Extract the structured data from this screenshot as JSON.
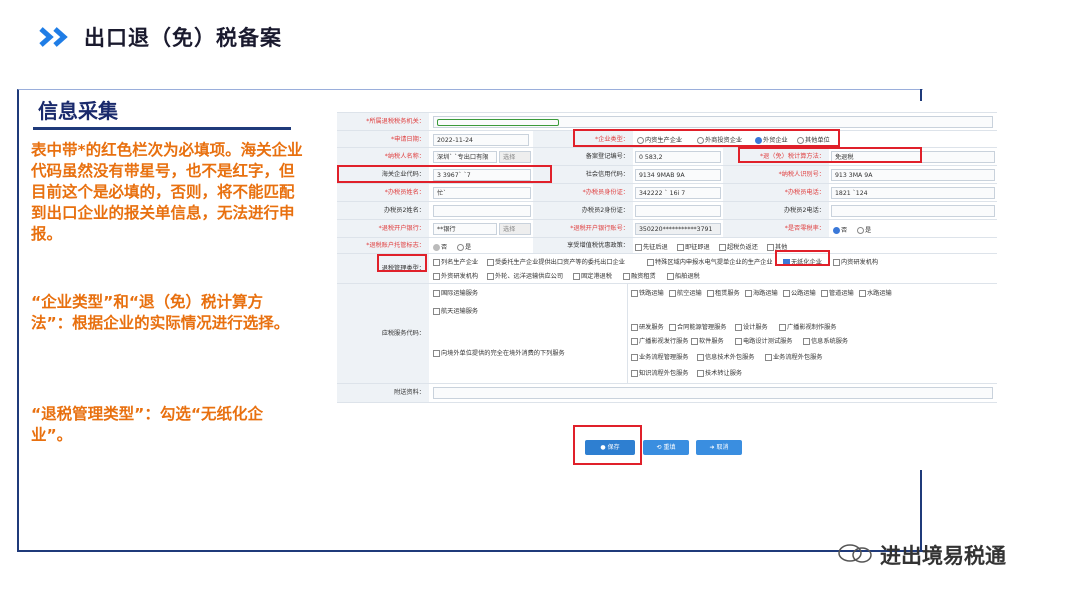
{
  "header": {
    "title": "出口退（免）税备案"
  },
  "section": {
    "title": "信息采集"
  },
  "notes": {
    "note1": "表中带*的红色栏次为必填项。海关企业代码虽然没有带星号，也不是红字，但目前这个是必填的，否则，将不能匹配到出口企业的报关单信息，无法进行申报。",
    "note2": "“企业类型”和“退（免）税计算方法”：根据企业的实际情况进行选择。",
    "note3": "“退税管理类型”：勾选“无纸化企业”。"
  },
  "form": {
    "r1": {
      "label": "*所属退税税务机关："
    },
    "r2": {
      "l1": "*申请日期：",
      "v1": "2022-11-24",
      "l2": "*企业类型：",
      "opts": [
        "内资生产企业",
        "外商投资企业",
        "外贸企业",
        "其他单位"
      ]
    },
    "r3": {
      "l1": "*纳税人名称：",
      "v1": "深圳`        `专出口有限",
      "sel": "选择",
      "l2": "备案登记编号：",
      "v2": "0        583,2",
      "l3": "*退（免）税计算方法：",
      "v3": "免退税"
    },
    "r4": {
      "l1": "海关企业代码：",
      "v1": "3         3967`  `7",
      "l2": "社会信用代码：",
      "v2": "9134      9MAB        9A",
      "l3": "*纳税人识别号：",
      "v3": "913         3MA              9A"
    },
    "r5": {
      "l1": "*办税员姓名：",
      "v1": "忙`",
      "l2": "*办税员身份证：",
      "v2": "342222      `  16i  7",
      "l3": "*办税员电话：",
      "v3": "1821        `124"
    },
    "r6": {
      "l1": "办税员2姓名：",
      "l2": "办税员2身份证：",
      "l3": "办税员2电话："
    },
    "r7": {
      "l1": "*退税开户银行：",
      "v1": "**银行",
      "sel": "选择",
      "l2": "*退税开户银行账号：",
      "v2": "350220***********3791",
      "l3": "*是否零税率：",
      "r_yes": "否",
      "r_no": "是"
    },
    "r8": {
      "l1": "*退税账户托管标志：",
      "r1": "否",
      "r2": "是",
      "l2": "享受增值税优惠政策：",
      "opts": [
        "先征后退",
        "即征即退",
        "超税负返还",
        "其他"
      ]
    },
    "r9": {
      "l1": "退税管理类型：",
      "opts1": [
        "列名生产企业",
        "受委托生产企业提供出口资产等的委托出口企业",
        "特殊区域内申报水电气提单企业的生产企业",
        "无纸化企业",
        "内资研发机构"
      ],
      "opts2": [
        "外资研发机构",
        "外轮、远洋运输供应公司",
        "固定港退税",
        "融资租赁",
        "船舶退税"
      ]
    },
    "r10": {
      "l1": "应税服务代码：",
      "col_left": [
        "国际运输服务",
        "航天运输服务",
        "向境外单位提供的完全在境外消费的下列服务"
      ],
      "col_right": [
        "铁路运输",
        "航空运输",
        "租赁服务",
        "海路运输",
        "公路运输",
        "管道运输",
        "水路运输",
        "研发服务",
        "合同能源管理服务",
        "设计服务",
        "广播影视制作服务",
        "广播影视发行服务",
        "软件服务",
        "电路设计测试服务",
        "信息系统服务",
        "业务流程管理服务",
        "信息技术外包服务",
        "业务流程外包服务",
        "知识流程外包服务",
        "技术转让服务"
      ]
    },
    "r11": {
      "l1": "附送资料："
    }
  },
  "buttons": {
    "save": "保存",
    "reset": "重填",
    "cancel": "取消"
  },
  "watermark": "进出境易税通",
  "colors": {
    "accent": "#e8700f",
    "navy": "#1f3a7a",
    "highlight": "#e0202a",
    "button": "#2e7fd1"
  }
}
